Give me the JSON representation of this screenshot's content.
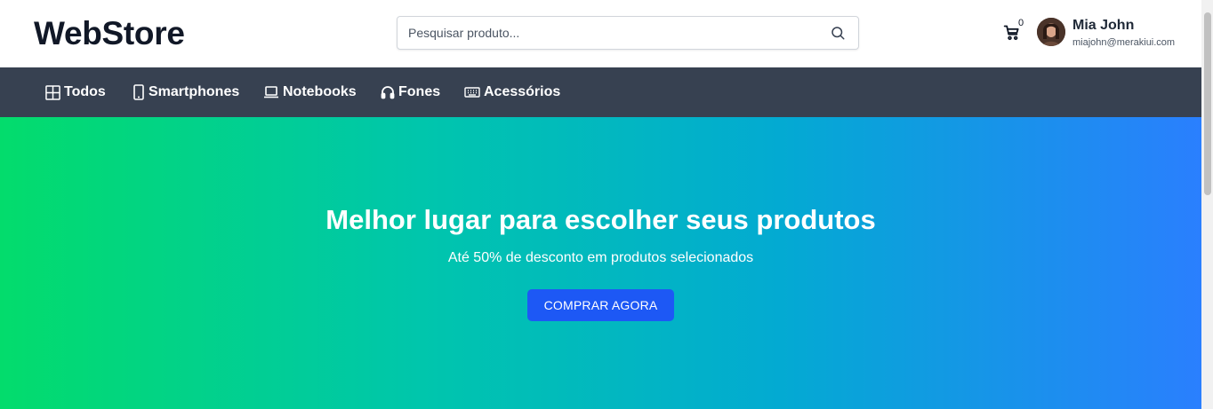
{
  "header": {
    "logo": "WebStore",
    "search": {
      "placeholder": "Pesquisar produto...",
      "value": ""
    },
    "cart": {
      "count": "0"
    },
    "user": {
      "name": "Mia John",
      "email": "miajohn@merakiui.com"
    }
  },
  "nav": {
    "items": [
      {
        "label": "Todos",
        "icon": "grid-icon"
      },
      {
        "label": "Smartphones",
        "icon": "smartphone-icon"
      },
      {
        "label": "Notebooks",
        "icon": "laptop-icon"
      },
      {
        "label": "Fones",
        "icon": "headphones-icon"
      },
      {
        "label": "Acessórios",
        "icon": "keyboard-icon"
      }
    ]
  },
  "hero": {
    "title": "Melhor lugar para escolher seus produtos",
    "subtitle": "Até 50% de desconto em produtos selecionados",
    "cta": "COMPRAR AGORA"
  },
  "colors": {
    "nav_bg": "#374151",
    "hero_gradient_start": "#03dc6c",
    "hero_gradient_end": "#2a7ffe",
    "cta_bg": "#1d58f5"
  }
}
